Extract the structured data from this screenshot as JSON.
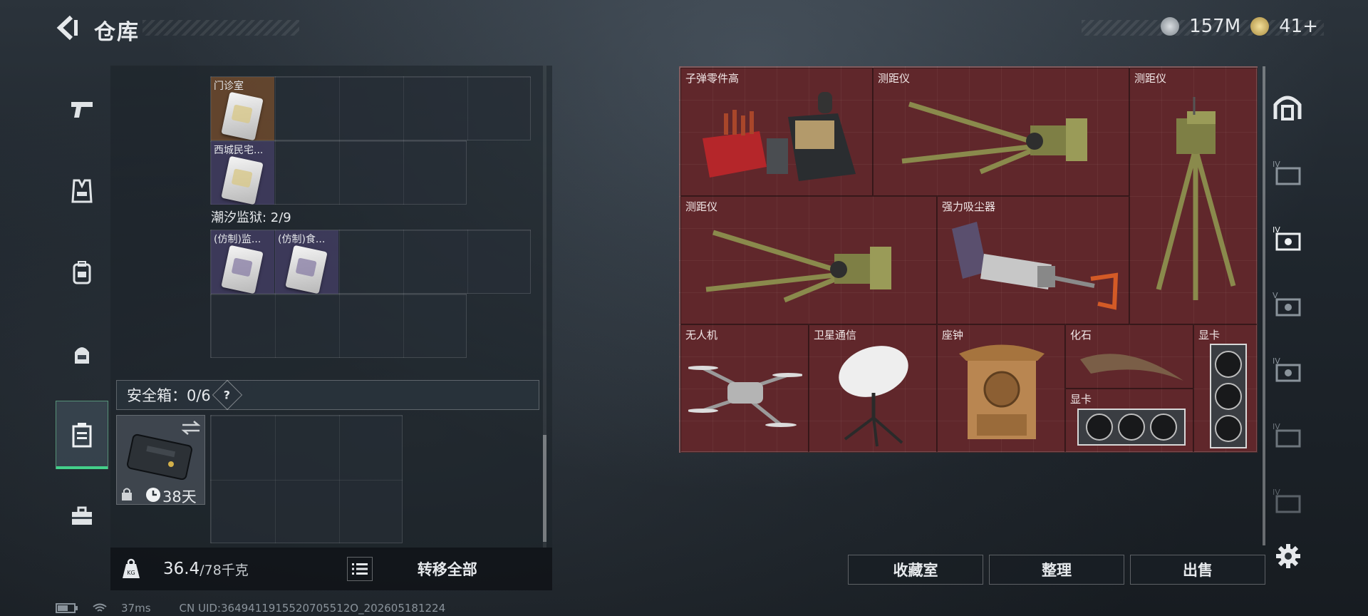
{
  "header": {
    "title": "仓库"
  },
  "currency": {
    "silver": "157M",
    "gold": "41+"
  },
  "left_nav": [
    {
      "icon": "pistol-icon"
    },
    {
      "icon": "vest-icon"
    },
    {
      "icon": "backpack-icon"
    },
    {
      "icon": "helmet-bag-icon"
    },
    {
      "icon": "safebox-icon",
      "active": true
    },
    {
      "icon": "toolbox-icon"
    }
  ],
  "storage": {
    "group1_cells": [
      {
        "label": "门诊室"
      },
      {
        "label": "西城民宅..."
      }
    ],
    "section_title": "潮汐监狱: 2/9",
    "group2_cells": [
      {
        "label": "(仿制)监..."
      },
      {
        "label": "(仿制)食..."
      }
    ]
  },
  "safebox": {
    "header": "安全箱：0/6",
    "help": "?",
    "duration": "38天"
  },
  "bottom_bar": {
    "weight_current": "36.4",
    "weight_max": "/78千克",
    "transfer_all": "转移全部"
  },
  "collection": {
    "items": [
      {
        "name": "子弹零件高"
      },
      {
        "name": "测距仪"
      },
      {
        "name": "测距仪"
      },
      {
        "name": "测距仪"
      },
      {
        "name": "强力吸尘器"
      },
      {
        "name": "无人机"
      },
      {
        "name": "卫星通信"
      },
      {
        "name": "座钟"
      },
      {
        "name": "化石"
      },
      {
        "name": "显卡"
      },
      {
        "name": "显卡"
      }
    ]
  },
  "right_nav": [
    {
      "icon": "vault-door-icon"
    },
    {
      "icon": "tier-iv-case-icon",
      "tier": "IV"
    },
    {
      "icon": "tier-iv-case-icon",
      "tier": "IV",
      "active": true
    },
    {
      "icon": "tier-v-case-icon",
      "tier": "V"
    },
    {
      "icon": "tier-iv-case-icon",
      "tier": "IV"
    },
    {
      "icon": "tier-iv-case-icon",
      "tier": "IV"
    },
    {
      "icon": "tier-iv-case-icon",
      "tier": "IV"
    }
  ],
  "actions": {
    "collection_room": "收藏室",
    "organize": "整理",
    "sell": "出售"
  },
  "status": {
    "ping": "37ms",
    "uid": "CN UID:3649411915520705512O_202605181224"
  }
}
